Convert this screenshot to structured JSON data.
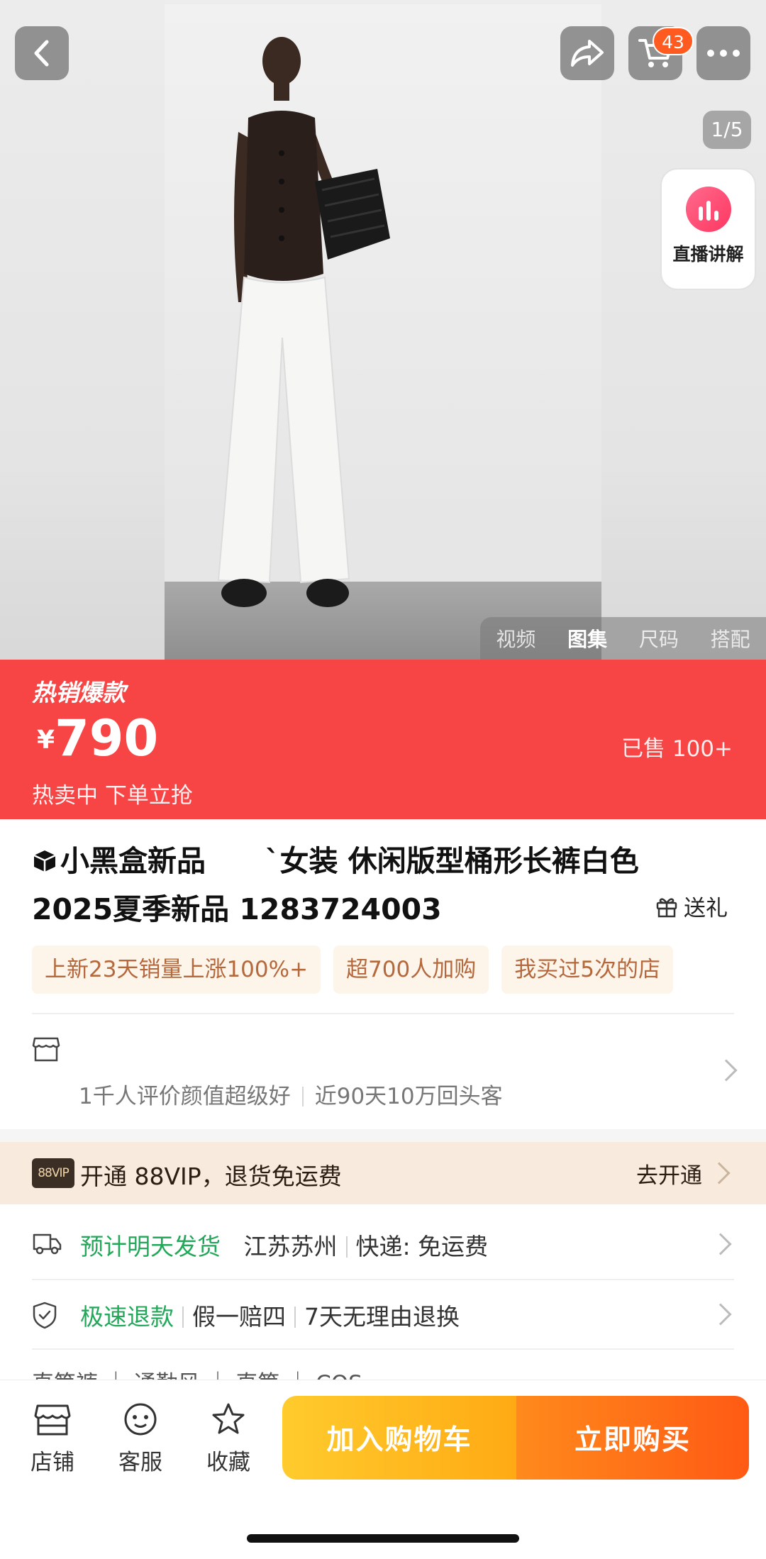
{
  "hero": {
    "cart_count": "43",
    "image_counter": "1/5",
    "live_label": "直播讲解",
    "media_tabs": [
      "视频",
      "图集",
      "尺码",
      "搭配"
    ],
    "active_media_tab": "图集"
  },
  "price_banner": {
    "hot_tag": "热销爆款",
    "currency": "¥",
    "price": "790",
    "sold": "已售 100+",
    "promo": "热卖中 下单立抢",
    "color": "#f74444"
  },
  "product": {
    "brand": "小黑盒新品",
    "title_line1": "`女装 休闲版型桶形长裤白色",
    "title_line2": "2025夏季新品 1283724003",
    "gift_label": "送礼",
    "tags": [
      "上新23天销量上涨100%+",
      "超700人加购",
      "我买过5次的店"
    ]
  },
  "store": {
    "rating_text": "1千人评价颜值超级好",
    "repeat_text": "近90天10万回头客"
  },
  "vip": {
    "badge": "88VIP",
    "text": "开通 88VIP，退货免运费",
    "action": "去开通"
  },
  "shipping": {
    "highlight": "预计明天发货",
    "origin": "江苏苏州",
    "delivery": "快递: 免运费"
  },
  "refund": {
    "highlight": "极速退款",
    "item1": "假一赔四",
    "item2": "7天无理由退换"
  },
  "partial_row": "直筒裤 ｜ 通勤风 ｜ 直筒 ｜ COS",
  "bottom_bar": {
    "shop": "店铺",
    "service": "客服",
    "favorite": "收藏",
    "add_to_cart": "加入购物车",
    "buy_now": "立即购买"
  },
  "colors": {
    "accent_red": "#f74444",
    "green": "#23a85a",
    "cart_yellow": "#ffb41e",
    "buy_orange": "#ff6a18"
  }
}
